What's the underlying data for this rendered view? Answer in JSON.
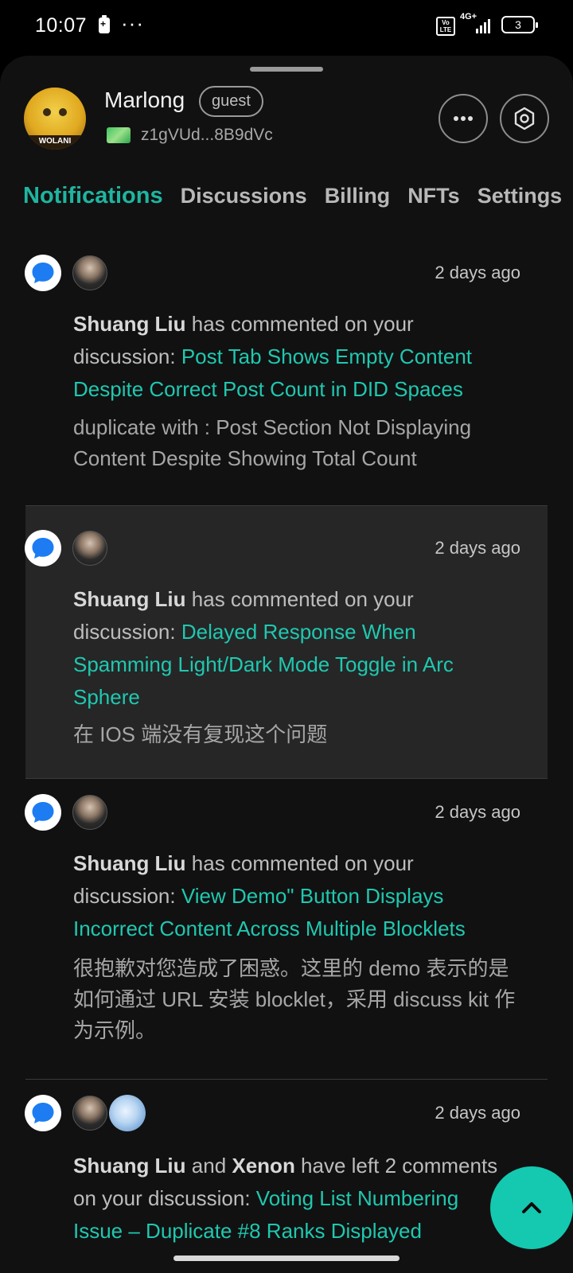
{
  "status_bar": {
    "time": "10:07",
    "dots": "···",
    "volte": "Vo LTE",
    "network": "4G+",
    "battery": "3"
  },
  "profile": {
    "avatar_caption": "WOLANI",
    "name": "Marlong",
    "role_badge": "guest",
    "did": "z1gVUd...8B9dVc"
  },
  "tabs": [
    {
      "label": "Notifications",
      "active": true
    },
    {
      "label": "Discussions",
      "active": false
    },
    {
      "label": "Billing",
      "active": false
    },
    {
      "label": "NFTs",
      "active": false
    },
    {
      "label": "Settings",
      "active": false
    }
  ],
  "notifications": [
    {
      "time": "2 days ago",
      "actor": "Shuang Liu",
      "action": " has commented on your discussion: ",
      "title": "Post Tab Shows Empty Content Despite Correct Post Count in DID Spaces",
      "excerpt": "duplicate with : Post Section Not Displaying Content Despite Showing Total Count"
    },
    {
      "time": "2 days ago",
      "actor": "Shuang Liu",
      "action": " has commented on your discussion: ",
      "title": "Delayed Response When Spamming Light/Dark Mode Toggle in Arc Sphere",
      "excerpt": "在 IOS 端没有复现这个问题"
    },
    {
      "time": "2 days ago",
      "actor": "Shuang Liu",
      "action": " has commented on your discussion: ",
      "title": "View Demo\" Button Displays Incorrect Content Across Multiple Blocklets",
      "excerpt": "很抱歉对您造成了困惑。这里的 demo 表示的是如何通过 URL 安装 blocklet，采用 discuss kit 作为示例。"
    },
    {
      "time": "2 days ago",
      "actor": "Shuang Liu",
      "connector": " and ",
      "actor2": "Xenon",
      "action": " have left 2 comments on your discussion: ",
      "title": "Voting List Numbering Issue – Duplicate #8 Ranks Displayed"
    }
  ],
  "colors": {
    "accent": "#1fb5a0",
    "link": "#1fc8b0",
    "chat_icon": "#1d7cf2",
    "fab": "#14c9b0"
  },
  "icons": {
    "more": "more-horizontal-icon",
    "settings": "hexagon-settings-icon",
    "chat": "chat-bubble-icon",
    "fab": "chevron-up-icon"
  }
}
